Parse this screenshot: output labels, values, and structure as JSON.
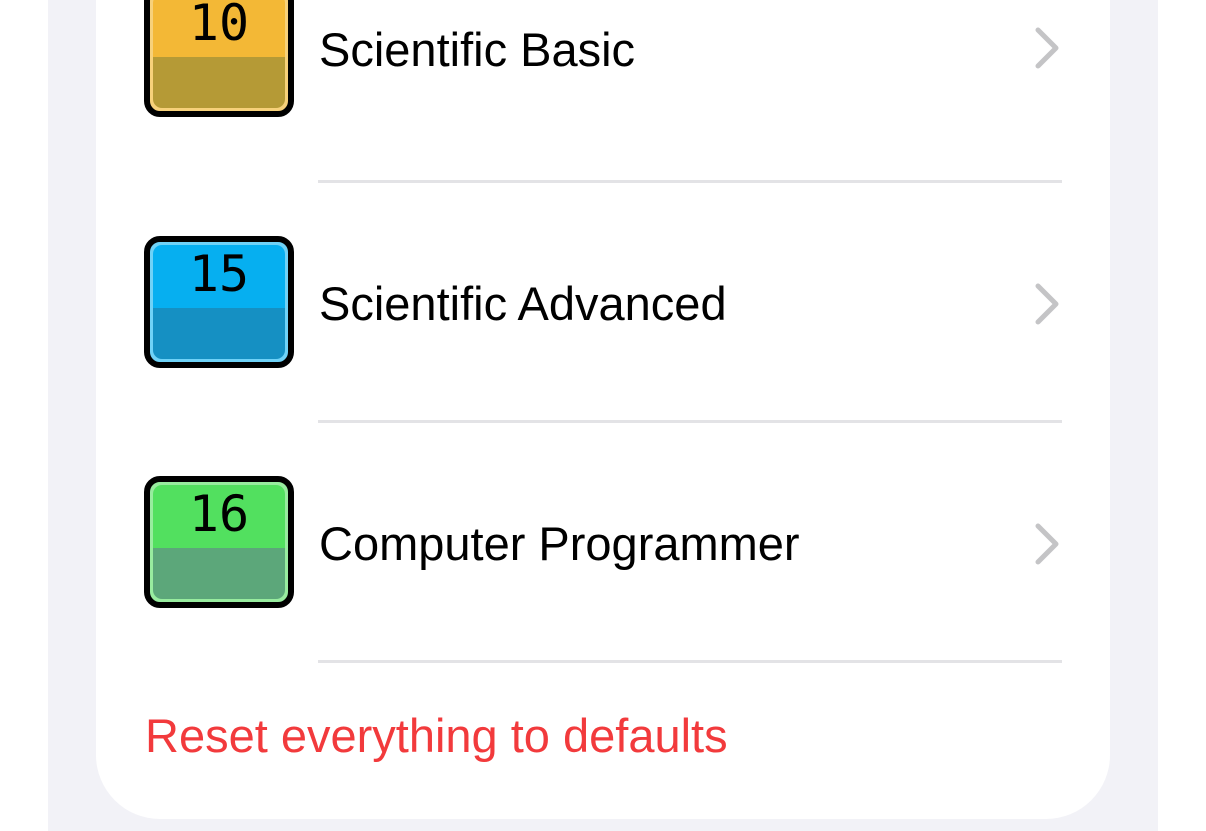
{
  "colors": {
    "page_background": "#f2f2f7",
    "card_background": "#ffffff",
    "separator": "#e3e3e6",
    "chevron": "#c4c4c6",
    "destructive": "#f23a3c"
  },
  "rows": [
    {
      "number": "10",
      "label": "Scientific Basic",
      "icon": "calculator-layout-icon",
      "icon_top_color": "#f3b836",
      "icon_bottom_color": "#b59a36",
      "icon_rim_color": "#f7d17a"
    },
    {
      "number": "15",
      "label": "Scientific Advanced",
      "icon": "calculator-layout-icon",
      "icon_top_color": "#06aff0",
      "icon_bottom_color": "#1590c3",
      "icon_rim_color": "#6fd2f7"
    },
    {
      "number": "16",
      "label": "Computer Programmer",
      "icon": "calculator-layout-icon",
      "icon_top_color": "#52e05f",
      "icon_bottom_color": "#5ca77a",
      "icon_rim_color": "#98ec9f"
    }
  ],
  "reset_label": "Reset everything to defaults"
}
